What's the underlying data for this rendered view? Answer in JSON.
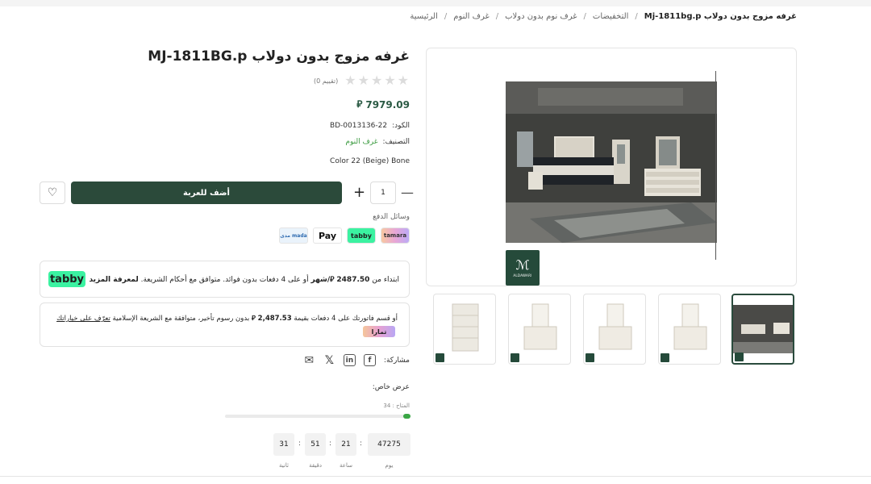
{
  "breadcrumb": {
    "home": "الرئيسية",
    "bedrooms": "غرف النوم",
    "no_wardrobe": "غرف نوم بدون دولاب",
    "discounts": "التخفيضات",
    "current": "غرفه مزوج بدون دولاب Mj-1811bg.p",
    "separator": "/"
  },
  "product": {
    "title": "غرفه مزوج بدون دولاب MJ-1811BG.p",
    "rating_count": "(0 تقييم)",
    "rating_value": 0,
    "price": "7979.09",
    "currency_symbol": "⃁",
    "code_label": "الكود:",
    "code_value": "BD-0013136-22",
    "category_label": "التصنيف:",
    "category_value": "غرف النوم",
    "color_text": "Color 22 (Beige) Bone"
  },
  "cart": {
    "add_label": "أضف للعربة",
    "quantity": "1",
    "plus": "+",
    "minus": "—",
    "wish_icon": "♡"
  },
  "payment": {
    "label": "وسائل الدفع",
    "methods": [
      "tamara",
      "tabby",
      "Pay",
      "mada"
    ],
    "mada_label": "مدى mada"
  },
  "tabby": {
    "logo": "tabby",
    "text_pre": "ابتداء من",
    "amount": "2487.50",
    "per": "/شهر",
    "text_post": "أو على 4 دفعات بدون فوائد. متوافق مع أحكام الشريعة.",
    "learn_more": "لمعرفة المزيد"
  },
  "tamara": {
    "text_pre": "أو قسم فاتورتك على 4 دفعات بقيمة",
    "amount": "2,487.53",
    "text_post": "بدون رسوم تأخير، متوافقة مع الشريعة الإسلامية",
    "link": "تعرّف على خياراتك",
    "logo": "تمارا"
  },
  "share": {
    "label": "مشاركة:"
  },
  "offer": {
    "label": "عرض خاص:",
    "stock_label": "المتاح : 34",
    "stock_fraction": 0.04
  },
  "countdown": {
    "days": "47275",
    "hours": "21",
    "minutes": "51",
    "seconds": "31",
    "days_label": "يوم",
    "hours_label": "ساعة",
    "minutes_label": "دقيقة",
    "seconds_label": "ثانية",
    "sep": ":"
  },
  "colors": {
    "brand_green": "#2b4a3a",
    "price_green": "#2b5a44",
    "link_green": "#3a9a3f",
    "tabby_mint": "#3bf2a1"
  }
}
